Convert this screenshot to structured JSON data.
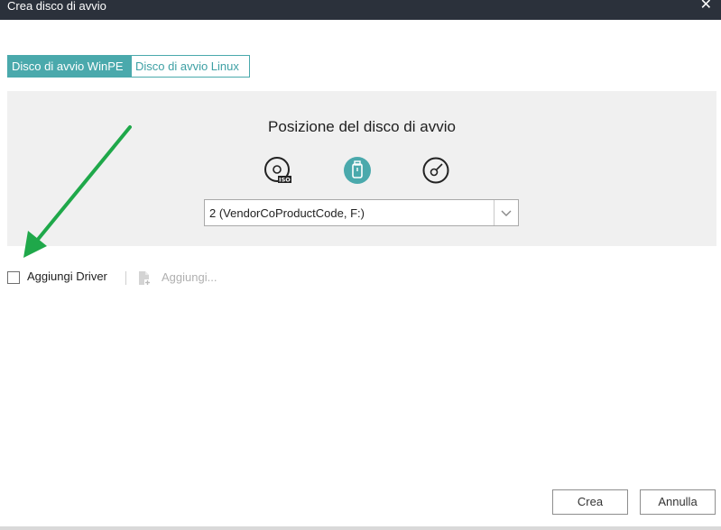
{
  "window": {
    "title": "Crea disco di avvio",
    "close_glyph": "✕"
  },
  "tabs": [
    {
      "label": "Disco di avvio WinPE",
      "active": true
    },
    {
      "label": "Disco di avvio Linux",
      "active": false
    }
  ],
  "panel": {
    "title": "Posizione del disco di avvio",
    "icons": [
      {
        "name": "iso-disc-icon",
        "selected": false
      },
      {
        "name": "usb-drive-icon",
        "selected": true
      },
      {
        "name": "cd-dvd-icon",
        "selected": false
      }
    ],
    "device_select": {
      "value": "2 (VendorCoProductCode, F:)"
    }
  },
  "driver": {
    "checkbox_label": "Aggiungi Driver",
    "checked": false,
    "add_label": "Aggiungi..."
  },
  "footer": {
    "create_label": "Crea",
    "cancel_label": "Annulla"
  },
  "colors": {
    "accent": "#4aa9ac",
    "titlebar": "#2b313b",
    "annotation_arrow": "#1fa84a"
  }
}
